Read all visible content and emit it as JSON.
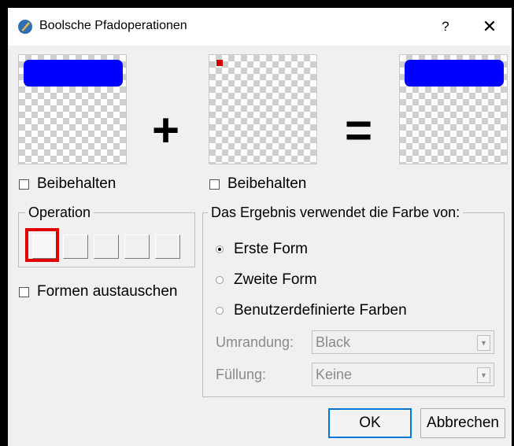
{
  "window": {
    "title": "Boolsche Pfadoperationen",
    "help": "?",
    "close": "✕"
  },
  "operators": {
    "plus": "+",
    "equals": "="
  },
  "left": {
    "keep_label": "Beibehalten"
  },
  "right": {
    "keep_label": "Beibehalten"
  },
  "operation": {
    "legend": "Operation",
    "buttons": 5,
    "selected_index": 0
  },
  "swap": {
    "label": "Formen austauschen"
  },
  "result_color": {
    "legend": "Das Ergebnis verwendet die Farbe von:",
    "options": [
      "Erste Form",
      "Zweite Form",
      "Benutzerdefinierte Farben"
    ],
    "selected": "Erste Form",
    "outline_label": "Umrandung:",
    "outline_value": "Black",
    "fill_label": "Füllung:",
    "fill_value": "Keine"
  },
  "buttons": {
    "ok": "OK",
    "cancel": "Abbrechen"
  },
  "colors": {
    "shape_blue": "#0000ff",
    "shape_red": "#d00000",
    "highlight": "#e00000",
    "default_button_border": "#0078d7"
  }
}
